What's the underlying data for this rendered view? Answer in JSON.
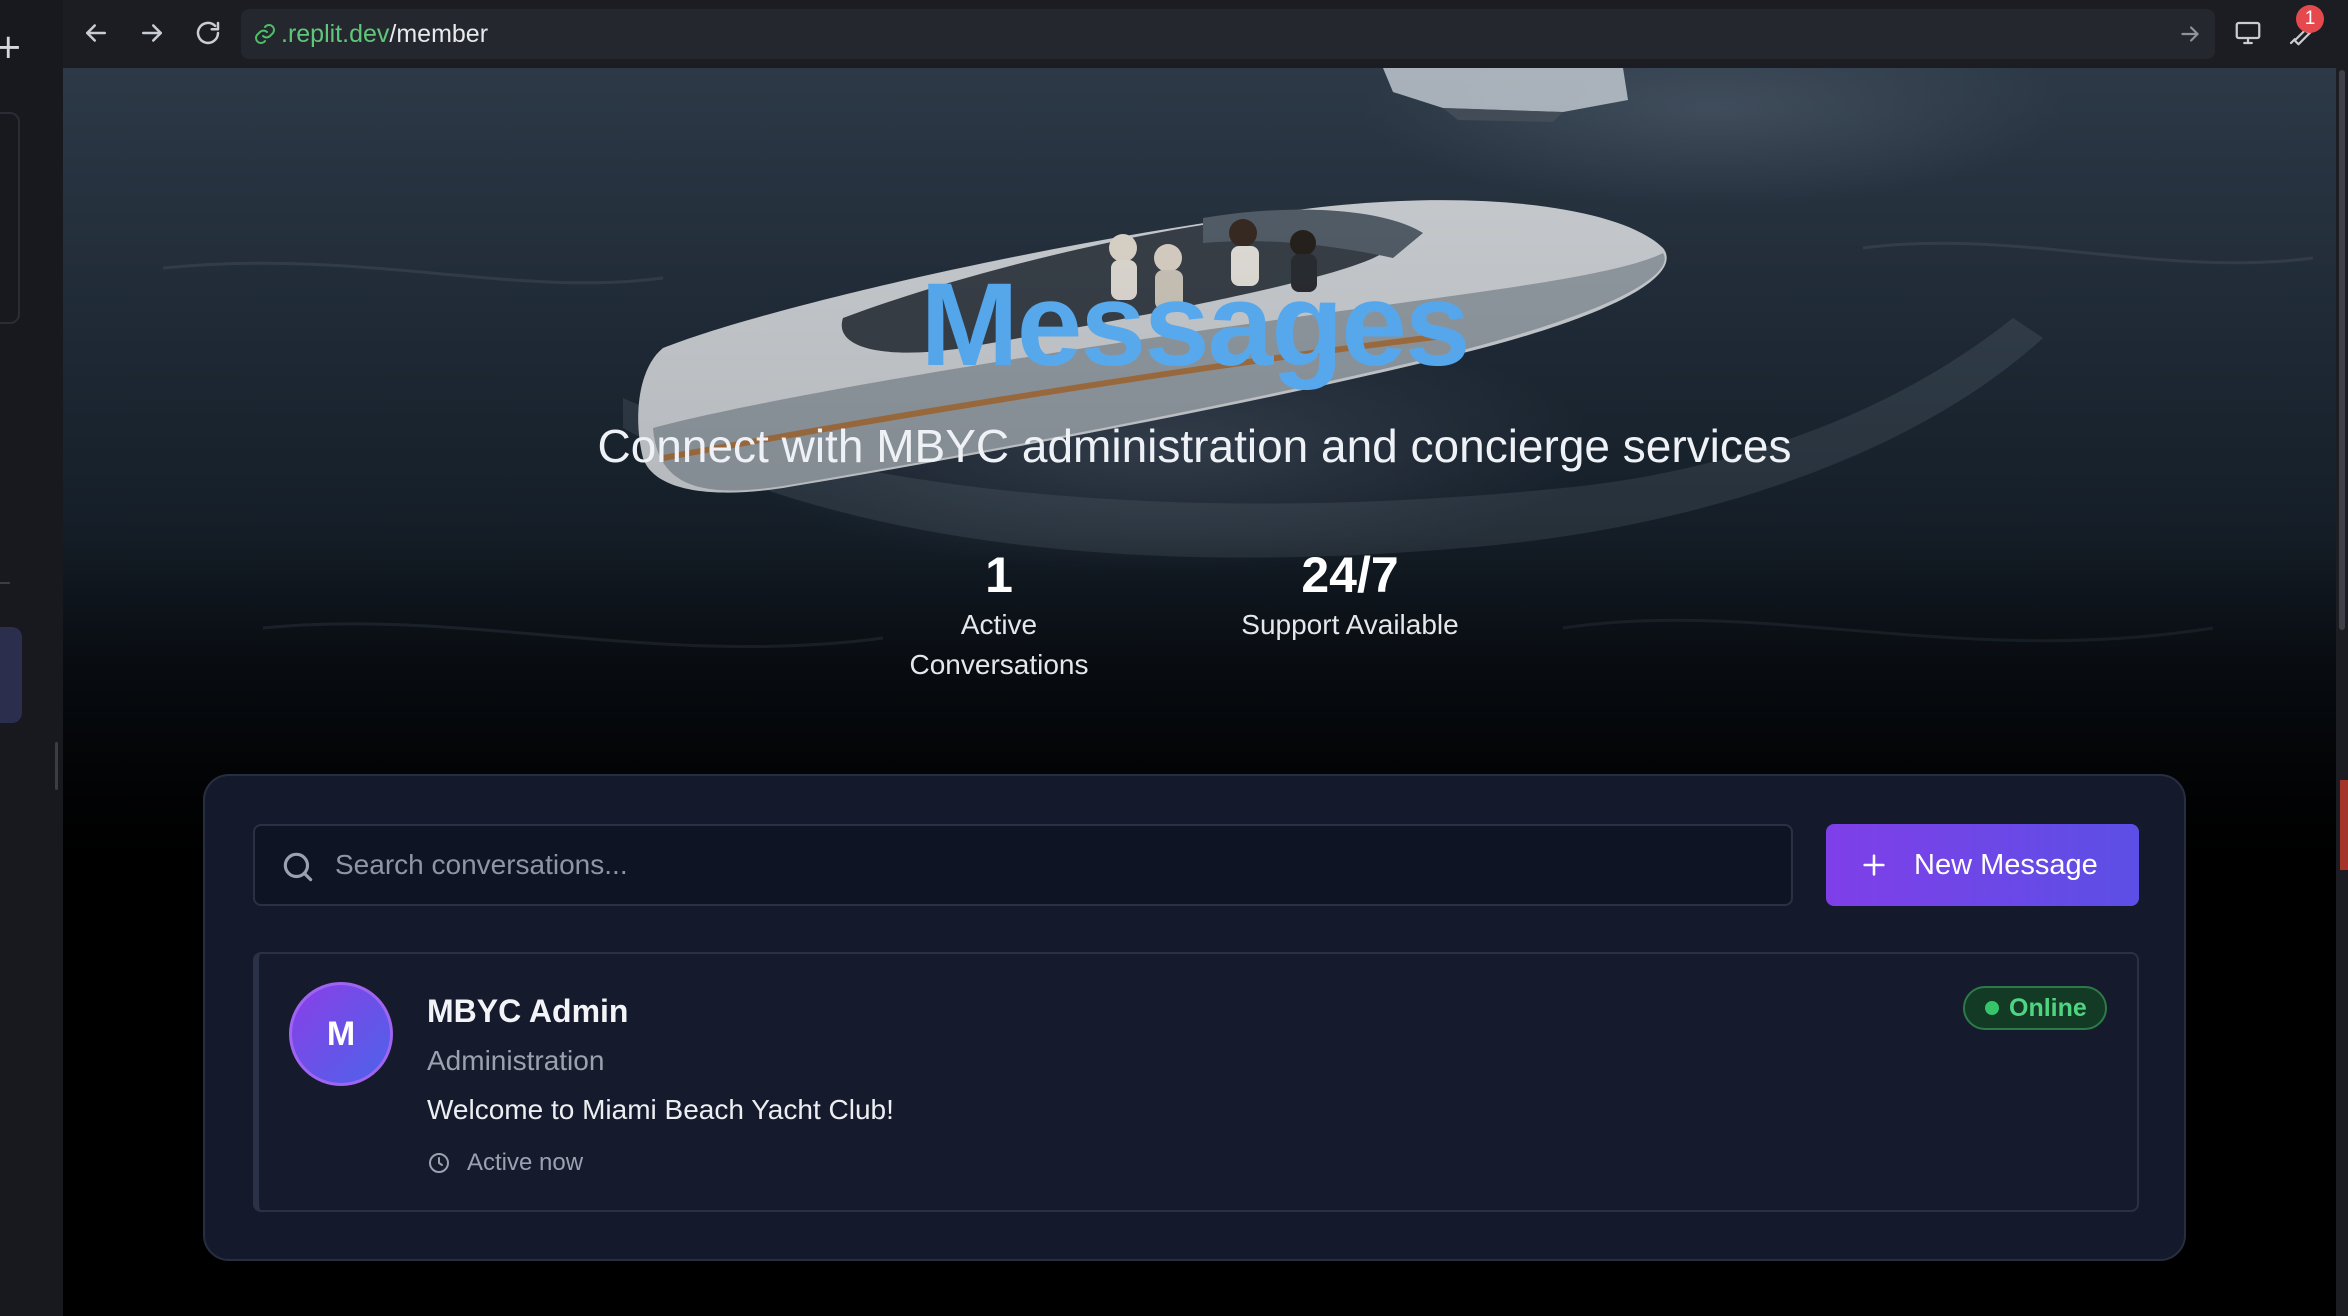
{
  "browser": {
    "url_host": ".replit.dev",
    "url_path": "/member",
    "notification_count": "1"
  },
  "hero": {
    "title": "Messages",
    "subtitle": "Connect with MBYC administration and concierge services",
    "stats": [
      {
        "value": "1",
        "label": "Active Conversations"
      },
      {
        "value": "24/7",
        "label": "Support Available"
      }
    ]
  },
  "search": {
    "placeholder": "Search conversations..."
  },
  "actions": {
    "new_message_label": "New Message"
  },
  "conversations": [
    {
      "avatar_initial": "M",
      "name": "MBYC Admin",
      "role": "Administration",
      "last_message": "Welcome to Miami Beach Yacht Club!",
      "activity": "Active now",
      "status": "Online"
    }
  ],
  "colors": {
    "accent_purple": "#7f3fe8",
    "title_blue": "#4d9fe6",
    "online_green": "#35c46a",
    "card_bg": "#141a2b"
  },
  "icons": [
    "back-icon",
    "forward-icon",
    "reload-icon",
    "link-icon",
    "go-arrow-icon",
    "monitor-icon",
    "wrench-icon",
    "external-link-icon",
    "search-icon",
    "plus-icon",
    "clock-icon"
  ]
}
